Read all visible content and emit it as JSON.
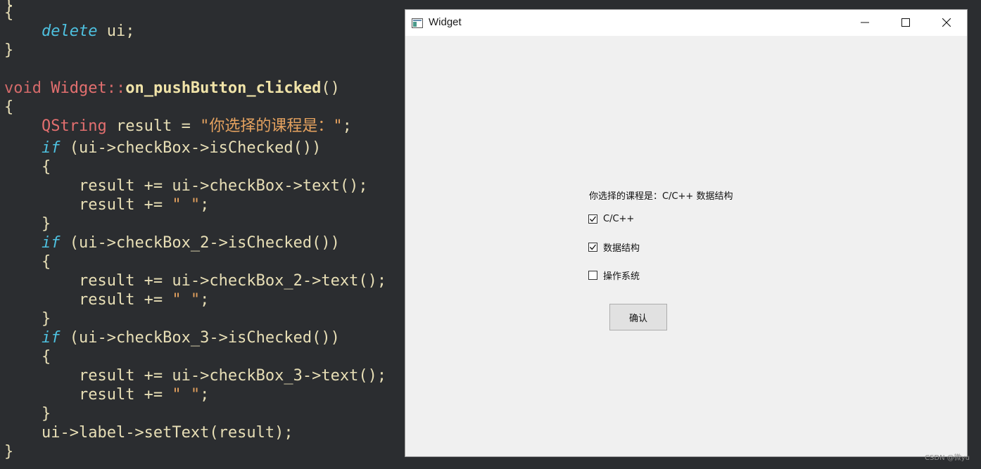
{
  "editor": {
    "lines": {
      "l0a": "{",
      "l1_kw": "delete",
      "l1_rest": " ui;",
      "l2": "}",
      "l3_void": "void",
      "l3_cls": "Widget",
      "l3_sep": "::",
      "l3_fn": "on_pushButton_clicked",
      "l3_paren": "()",
      "l4": "{",
      "l5_type": "QString",
      "l5_mid": " result = ",
      "l5_str": "\"你选择的课程是：\"",
      "l5_end": ";",
      "l6_if": "if",
      "l6_rest": " (ui->checkBox->isChecked())",
      "l7": "{",
      "l8": "result += ui->checkBox->text();",
      "l9_a": "result += ",
      "l9_s": "\" \"",
      "l9_b": ";",
      "l10": "}",
      "l11_if": "if",
      "l11_rest": " (ui->checkBox_2->isChecked())",
      "l12": "{",
      "l13": "result += ui->checkBox_2->text();",
      "l14_a": "result += ",
      "l14_s": "\" \"",
      "l14_b": ";",
      "l15": "}",
      "l16_if": "if",
      "l16_rest": " (ui->checkBox_3->isChecked())",
      "l17": "{",
      "l18": "result += ui->checkBox_3->text();",
      "l19_a": "result += ",
      "l19_s": "\" \"",
      "l19_b": ";",
      "l20": "}",
      "l21": "ui->label->setText(result);",
      "l22": "}"
    }
  },
  "window": {
    "title": "Widget",
    "icons": {
      "app": "app-window-icon",
      "minimize": "minimize-icon",
      "maximize": "maximize-icon",
      "close": "close-icon"
    },
    "result_label": "你选择的课程是：C/C++ 数据结构",
    "checkboxes": [
      {
        "label": "C/C++",
        "checked": true
      },
      {
        "label": "数据结构",
        "checked": true
      },
      {
        "label": "操作系统",
        "checked": false
      }
    ],
    "confirm_button": "确认"
  },
  "watermark": "CSDN @微yu"
}
